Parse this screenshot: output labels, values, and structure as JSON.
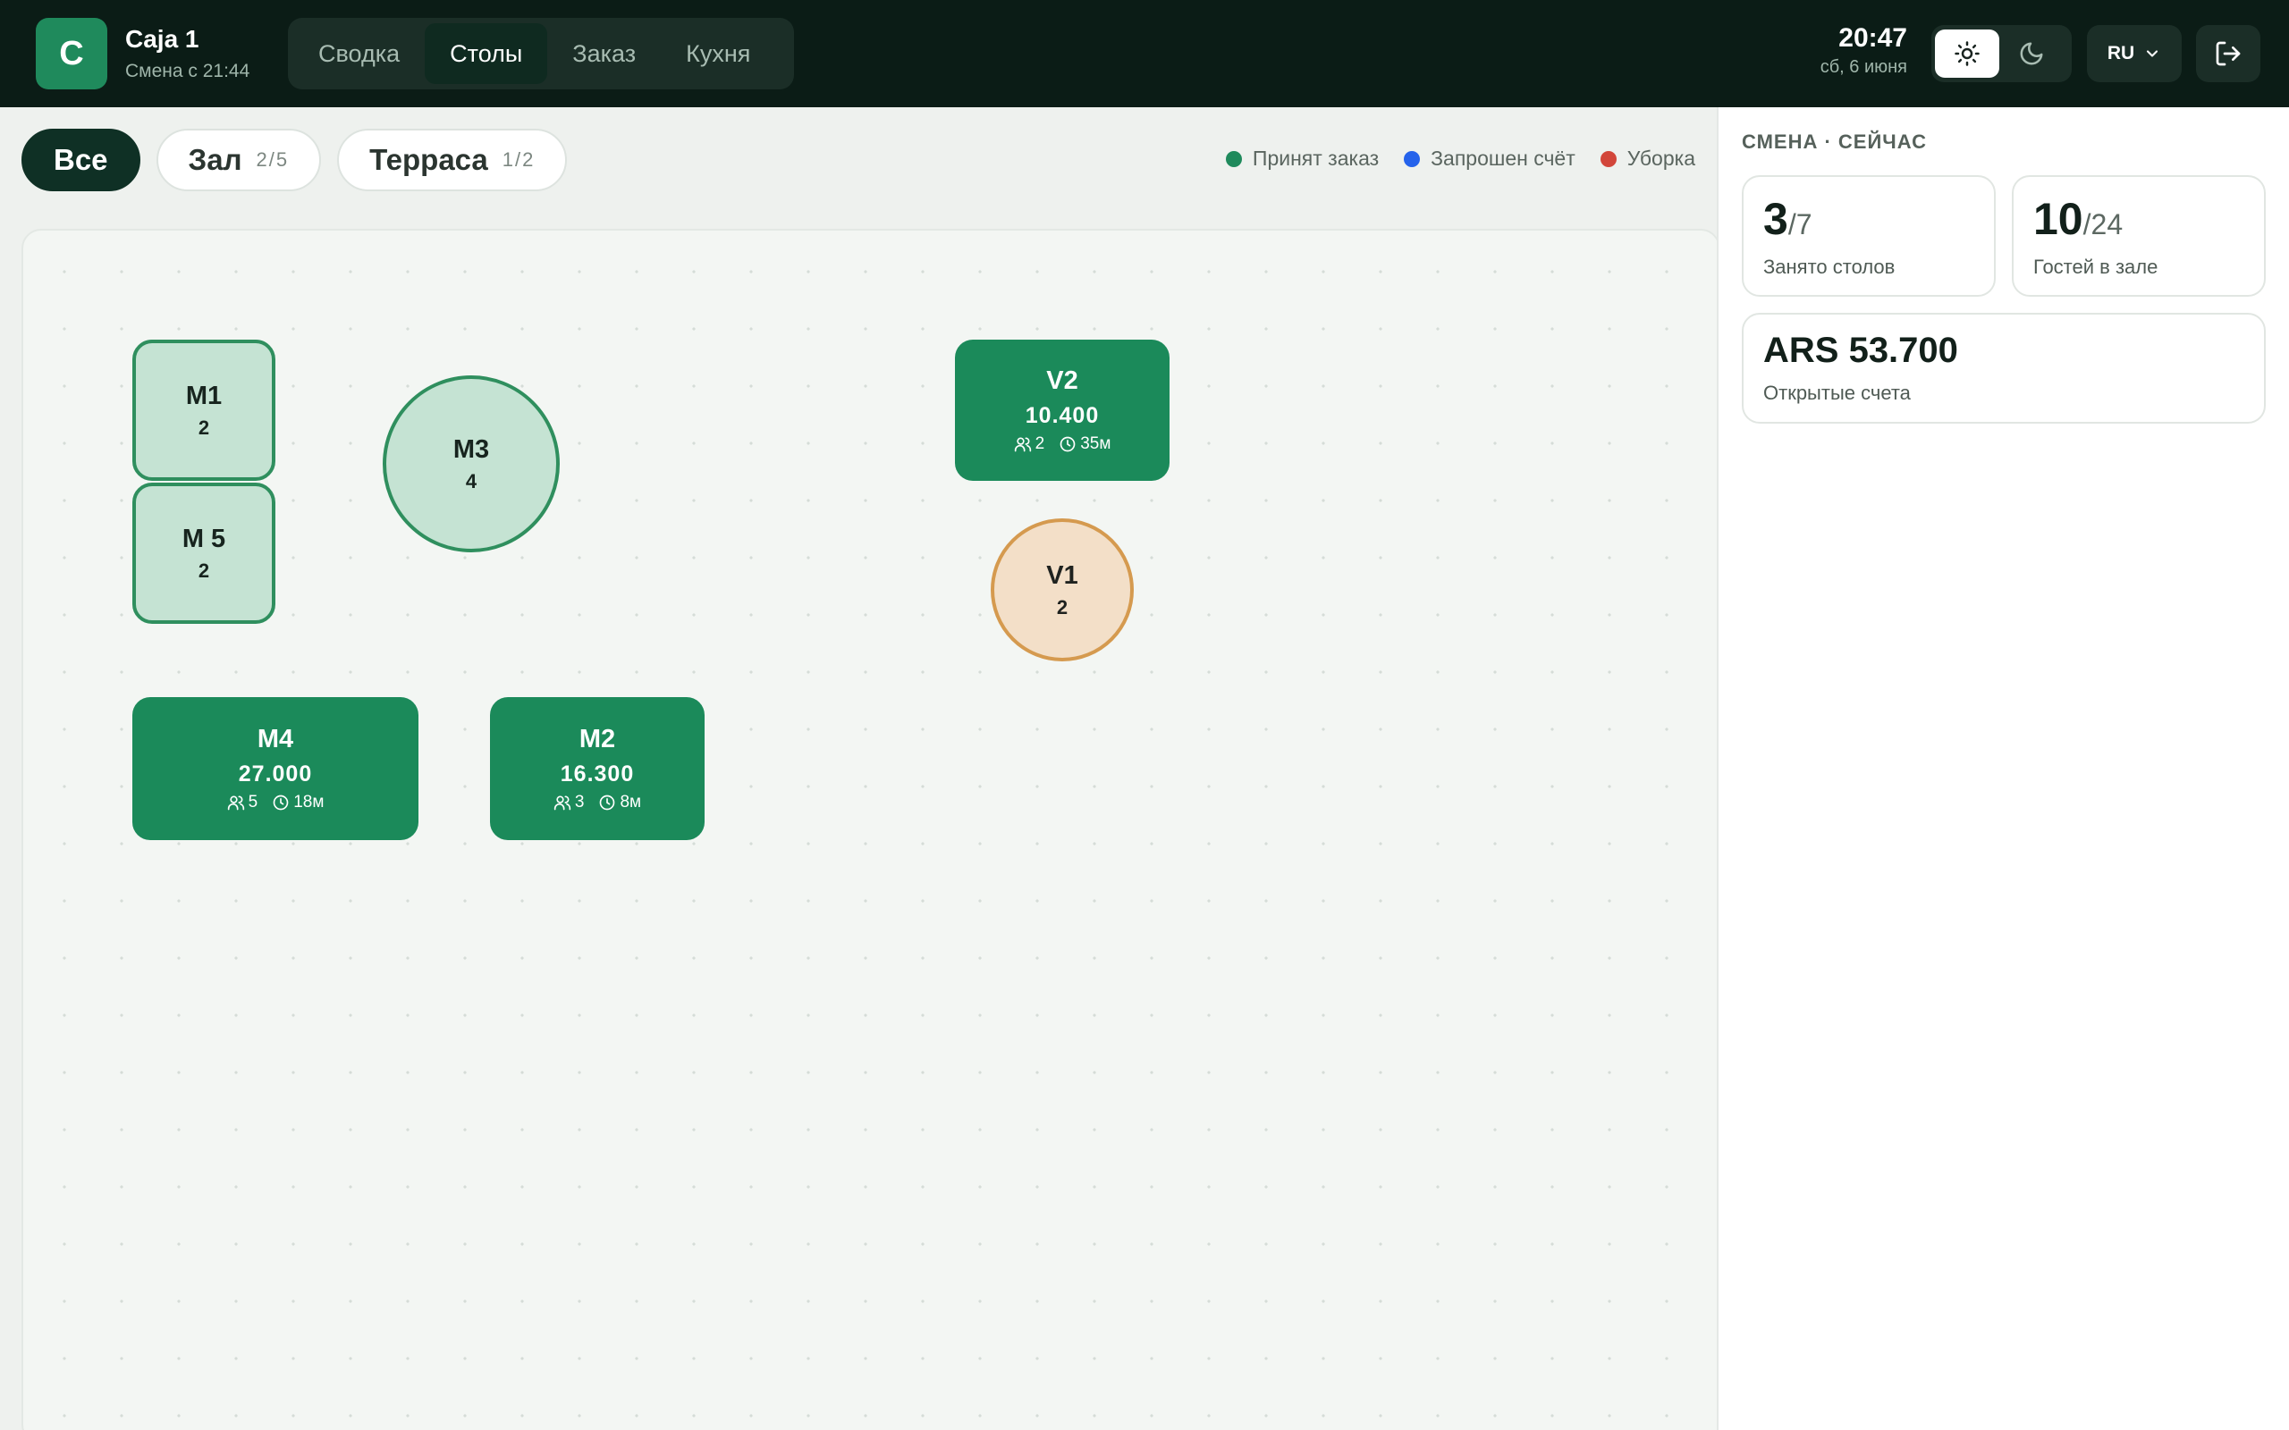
{
  "app": {
    "logo_letter": "C",
    "register_title": "Caja 1",
    "shift_started": "Смена с 21:44"
  },
  "nav": {
    "tabs": [
      {
        "label": "Сводка",
        "active": false
      },
      {
        "label": "Столы",
        "active": true
      },
      {
        "label": "Заказ",
        "active": false
      },
      {
        "label": "Кухня",
        "active": false
      }
    ]
  },
  "clock": {
    "time": "20:47",
    "date": "сб, 6 июня"
  },
  "theme": {
    "active": "light",
    "light_icon": "sun-icon",
    "dark_icon": "moon-icon"
  },
  "language": {
    "selected": "RU",
    "icon": "chevron-down-icon"
  },
  "logout": {
    "icon": "logout-icon"
  },
  "filters": [
    {
      "label": "Все",
      "count": "",
      "active": true
    },
    {
      "label": "Зал",
      "count": "2/5",
      "active": false
    },
    {
      "label": "Терраса",
      "count": "1/2",
      "active": false
    }
  ],
  "legend": [
    {
      "label": "Принят заказ",
      "color": "#1f8a5c"
    },
    {
      "label": "Запрошен счёт",
      "color": "#2563eb"
    },
    {
      "label": "Уборка",
      "color": "#d2463a"
    }
  ],
  "tables": {
    "m1": {
      "name": "M1",
      "seats": "2",
      "status": "free"
    },
    "m5": {
      "name": "M 5",
      "seats": "2",
      "status": "free"
    },
    "m3": {
      "name": "M3",
      "seats": "4",
      "status": "free"
    },
    "v2": {
      "name": "V2",
      "amount": "10.400",
      "guests": "2",
      "time": "35м",
      "status": "busy"
    },
    "v1": {
      "name": "V1",
      "seats": "2",
      "status": "cleaning"
    },
    "m4": {
      "name": "M4",
      "amount": "27.000",
      "guests": "5",
      "time": "18м",
      "status": "busy"
    },
    "m2": {
      "name": "M2",
      "amount": "16.300",
      "guests": "3",
      "time": "8м",
      "status": "busy"
    }
  },
  "panel": {
    "heading": "СМЕНА · СЕЙЧАС",
    "occupied": {
      "value": "3",
      "total": "/7",
      "label": "Занято столов"
    },
    "guests": {
      "value": "10",
      "total": "/24",
      "label": "Гостей в зале"
    },
    "open_bills": {
      "value": "ARS 53.700",
      "label": "Открытые счета"
    }
  }
}
